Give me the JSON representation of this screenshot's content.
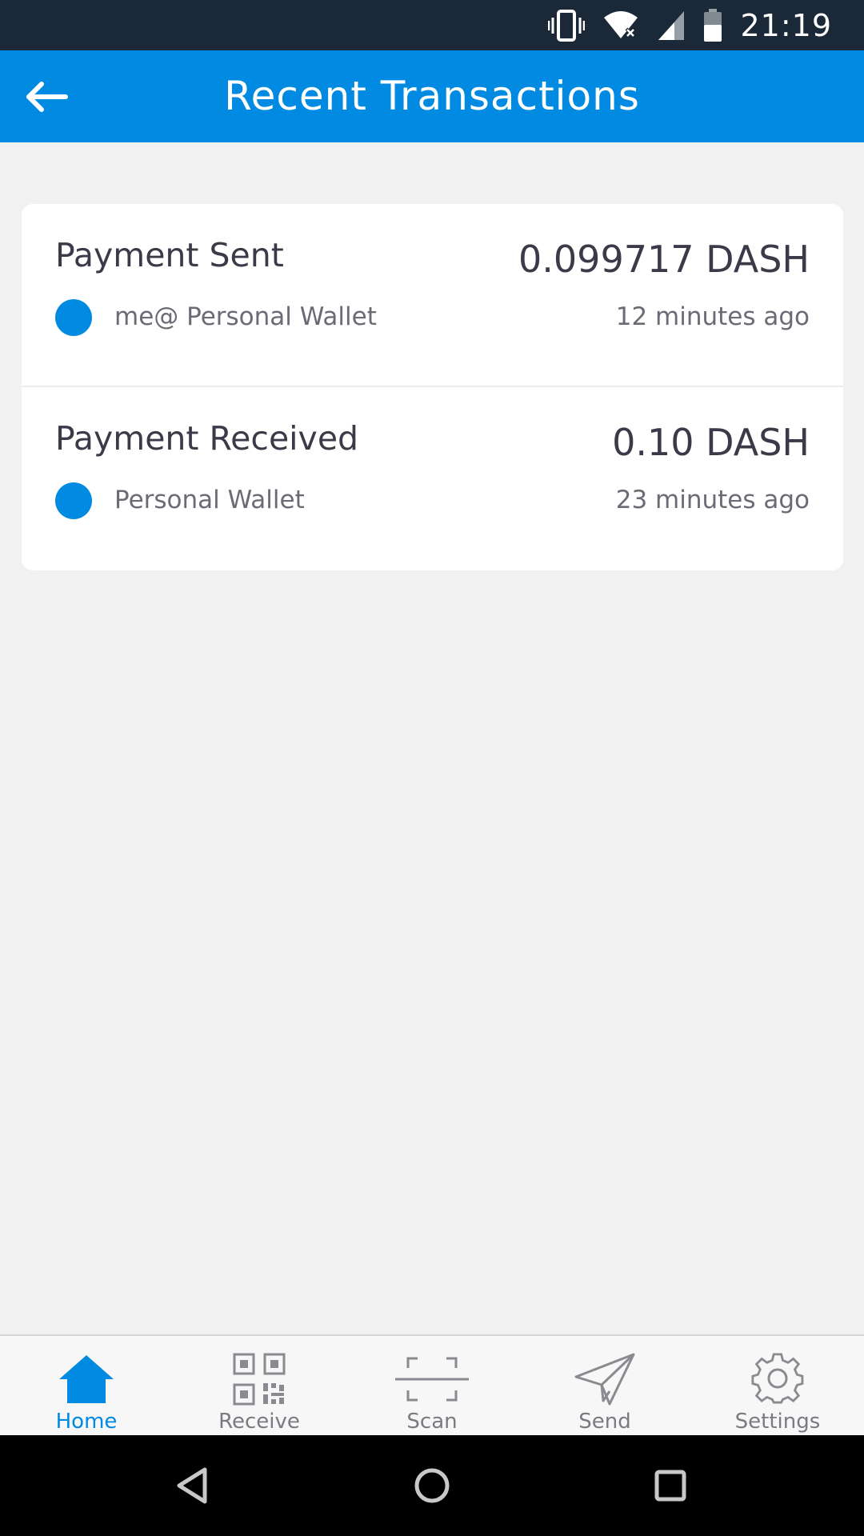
{
  "status_bar": {
    "time": "21:19",
    "icons": [
      "vibrate-icon",
      "wifi-off-icon",
      "signal-icon",
      "battery-icon"
    ]
  },
  "app_bar": {
    "title": "Recent Transactions",
    "back_icon": "arrow-left-icon"
  },
  "colors": {
    "accent": "#018ae2",
    "status_bar": "#1b2838",
    "background": "#f1f1f1"
  },
  "transactions": [
    {
      "title": "Payment Sent",
      "amount": "0.099717 DASH",
      "wallet": "me@ Personal Wallet",
      "time": "12 minutes ago"
    },
    {
      "title": "Payment Received",
      "amount": "0.10 DASH",
      "wallet": "Personal Wallet",
      "time": "23 minutes ago"
    }
  ],
  "bottom_nav": {
    "items": [
      {
        "label": "Home",
        "icon": "home-icon",
        "active": true
      },
      {
        "label": "Receive",
        "icon": "qr-code-icon",
        "active": false
      },
      {
        "label": "Scan",
        "icon": "scan-icon",
        "active": false
      },
      {
        "label": "Send",
        "icon": "paper-plane-icon",
        "active": false
      },
      {
        "label": "Settings",
        "icon": "gear-icon",
        "active": false
      }
    ]
  },
  "system_nav": [
    "back-triangle-icon",
    "home-circle-icon",
    "recents-square-icon"
  ]
}
